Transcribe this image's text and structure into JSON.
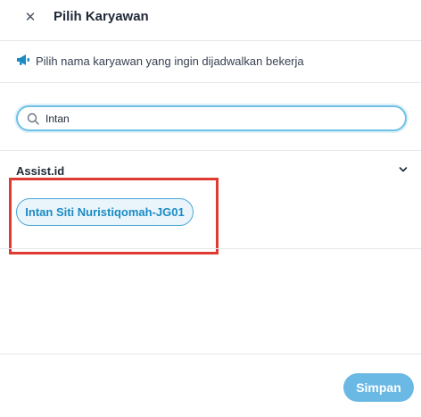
{
  "header": {
    "close_icon": "close-icon",
    "title": "Pilih Karyawan"
  },
  "info": {
    "icon": "megaphone-icon",
    "text": "Pilih nama karyawan yang ingin dijadwalkan bekerja"
  },
  "search": {
    "icon": "search-icon",
    "value": "Intan",
    "placeholder": ""
  },
  "groups": [
    {
      "name": "Assist.id",
      "expand_icon": "chevron-down-icon",
      "employees": [
        {
          "label": "Intan Siti Nuristiqomah-JG01"
        }
      ]
    }
  ],
  "footer": {
    "save_label": "Simpan"
  },
  "colors": {
    "accent": "#6ab8e4",
    "chip_border": "#4aa8d8",
    "chip_text": "#1c8bc4",
    "highlight": "#e03b32"
  }
}
